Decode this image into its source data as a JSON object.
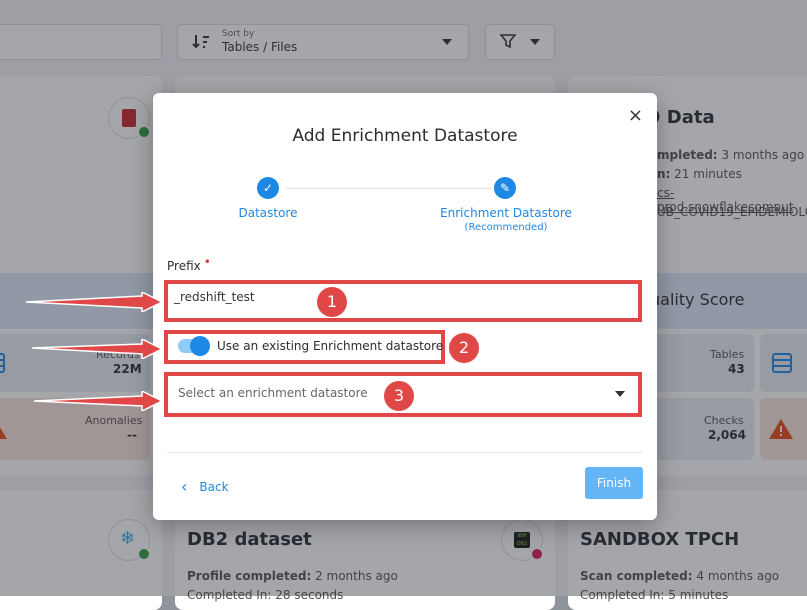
{
  "toolbar": {
    "sort_caption": "Sort by",
    "sort_value": "Tables / Files"
  },
  "background_cards": {
    "right_title_fragment": "9 Data",
    "right_line1_label": "mpleted:",
    "right_line1_value": "3 months ago",
    "right_line2_label": "n:",
    "right_line2_value": "21 minutes",
    "right_line3": "cs-prod.snowflakecomput",
    "right_line4": "UB_COVID19_EPIDEMIOLO",
    "quality_fragment": "uality Score",
    "records_label": "Records",
    "records_value": "22M",
    "anomalies_label": "Anomalies",
    "anomalies_value": "--",
    "tables_label": "Tables",
    "tables_value": "43",
    "checks_label": "Checks",
    "checks_value": "2,064",
    "db2_title": "DB2 dataset",
    "db2_line1_label": "Profile completed:",
    "db2_line1_value": "2 months ago",
    "db2_line2": "Completed In: 28 seconds",
    "sandbox_title": "SANDBOX TPCH",
    "sandbox_line1_label": "Scan completed:",
    "sandbox_line1_value": "4 months ago",
    "sandbox_line2": "Completed In: 5 minutes",
    "ibm_logo": "IBM DB2"
  },
  "modal": {
    "title": "Add Enrichment Datastore",
    "close_glyph": "×",
    "steps": [
      {
        "label": "Datastore",
        "sub": ""
      },
      {
        "label": "Enrichment Datastore",
        "sub": "(Recommended)"
      }
    ],
    "prefix_label": "Prefix",
    "prefix_required_mark": "•",
    "prefix_value": "_redshift_test",
    "toggle_label": "Use an existing Enrichment datastore",
    "toggle_on": true,
    "select_placeholder": "Select an enrichment datastore",
    "back_label": "Back",
    "finish_label": "Finish"
  },
  "annotations": [
    "1",
    "2",
    "3"
  ],
  "colors": {
    "accent": "#1e88e5",
    "highlight": "#e04848",
    "finish_disabled": "#64b5f6"
  }
}
